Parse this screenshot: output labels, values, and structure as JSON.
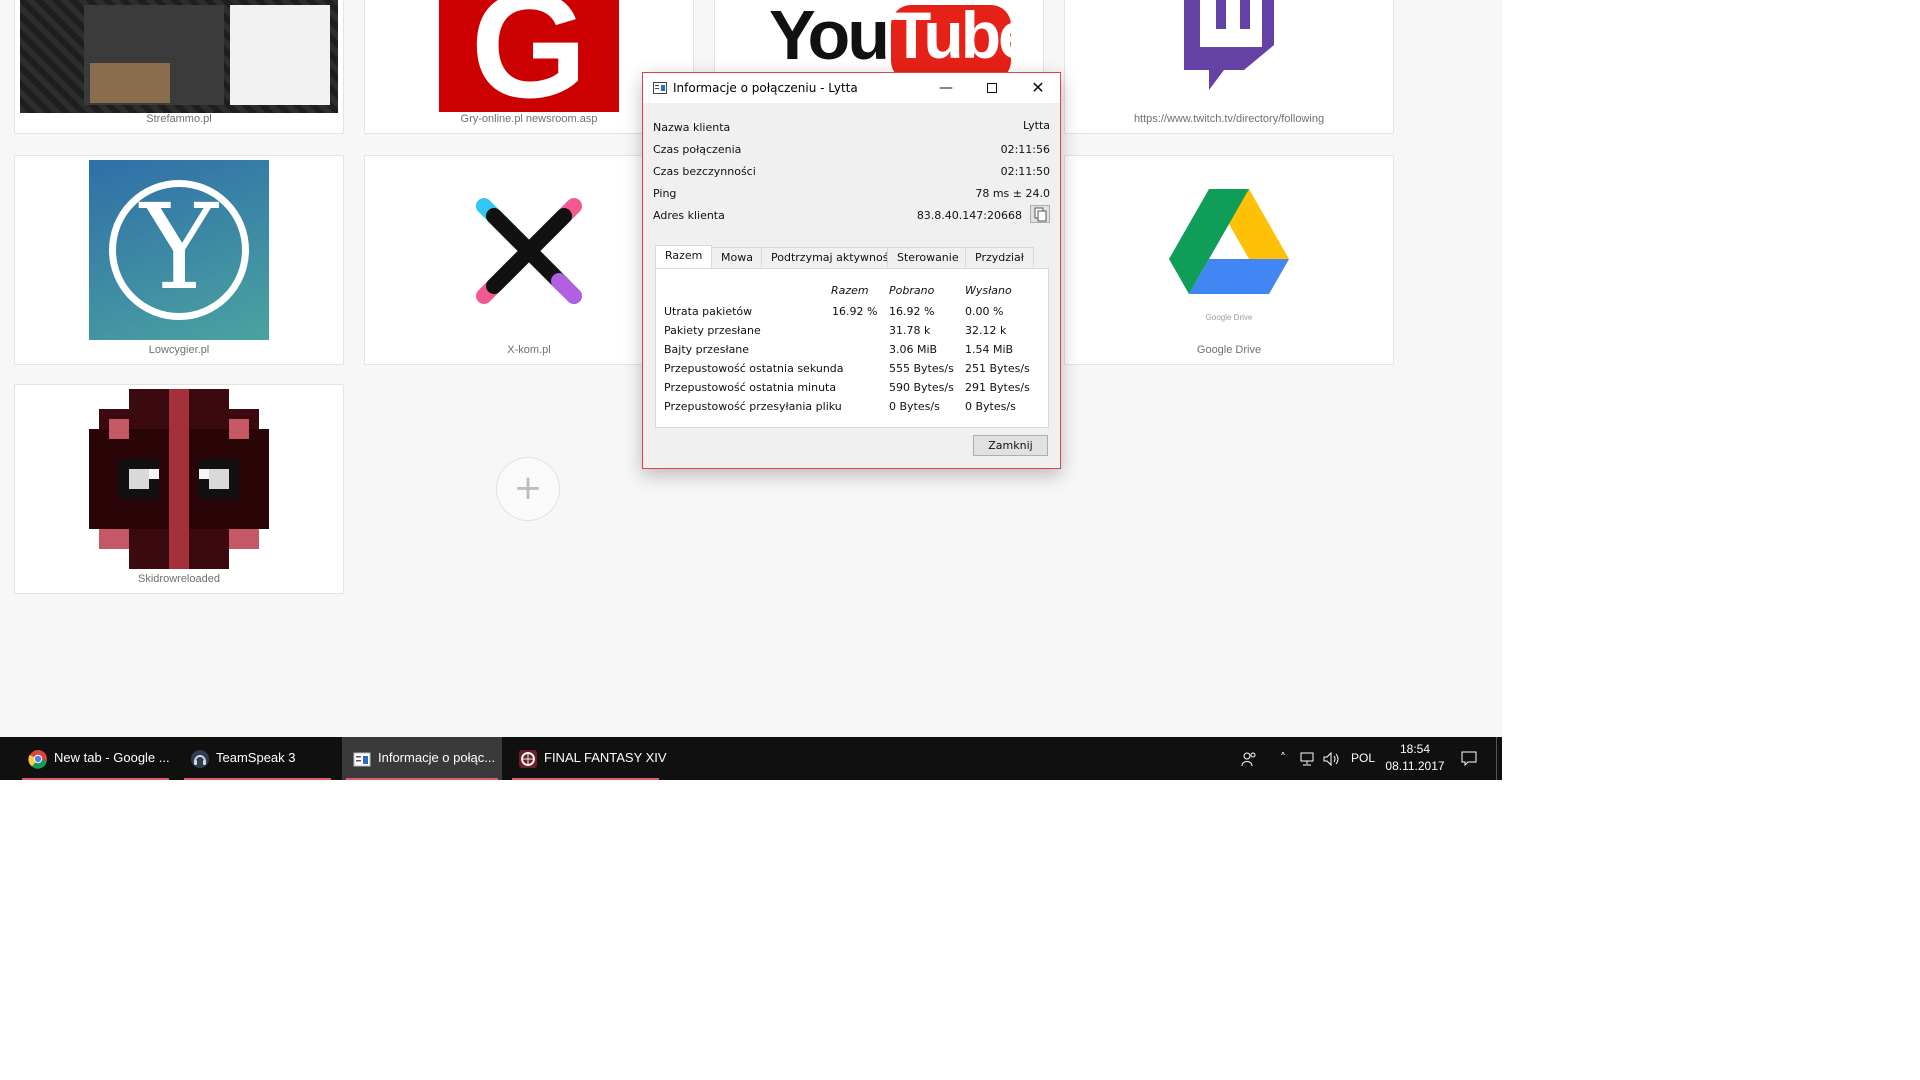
{
  "speed_dial": {
    "tiles": [
      {
        "label": "Strefammo.pl",
        "icon": "strefammo-thumbnail"
      },
      {
        "label": "Gry-online.pl newsroom.asp",
        "icon": "gry-online-logo",
        "logo_text": "G",
        "color": "#cc0000"
      },
      {
        "label": "YouTube",
        "icon": "youtube-logo",
        "logo_you": "You",
        "logo_tube": "Tube",
        "color": "#e62117"
      },
      {
        "label": "https://www.twitch.tv/directory/following",
        "icon": "twitch-logo",
        "color": "#6441a4"
      },
      {
        "label": "Lowcygier.pl",
        "icon": "lowcygier-logo",
        "logo_text": "Y",
        "color": "#3a7fae"
      },
      {
        "label": "X-kom.pl",
        "icon": "x-kom-logo"
      },
      {
        "label": "Google Drive",
        "icon": "google-drive-logo",
        "logo_text": "Google Drive"
      },
      {
        "label": "Skidrowreloaded",
        "icon": "deadpool-pixel-logo"
      }
    ],
    "add_label": "+"
  },
  "dialog": {
    "title": "Informacje o połączeniu - Lytta",
    "info": [
      {
        "label": "Nazwa klienta",
        "value": "Lytta"
      },
      {
        "label": "Czas połączenia",
        "value": "02:11:56"
      },
      {
        "label": "Czas bezczynności",
        "value": "02:11:50"
      },
      {
        "label": "Ping",
        "value": "78 ms ± 24.0"
      },
      {
        "label": "Adres klienta",
        "value": "83.8.40.147:20668"
      }
    ],
    "tabs": [
      "Razem",
      "Mowa",
      "Podtrzymaj aktywność",
      "Sterowanie",
      "Przydział"
    ],
    "active_tab": "Razem",
    "columns": [
      "Razem",
      "Pobrano",
      "Wysłano"
    ],
    "rows": [
      {
        "label": "Utrata pakietów",
        "total": "16.92 %",
        "down": "16.92 %",
        "up": "0.00 %"
      },
      {
        "label": "Pakiety przesłane",
        "total": "",
        "down": "31.78 k",
        "up": "32.12 k"
      },
      {
        "label": "Bajty przesłane",
        "total": "",
        "down": "3.06 MiB",
        "up": "1.54 MiB"
      },
      {
        "label": "Przepustowość ostatnia sekunda",
        "total": "",
        "down": "555 Bytes/s",
        "up": "251 Bytes/s"
      },
      {
        "label": "Przepustowość ostatnia minuta",
        "total": "",
        "down": "590 Bytes/s",
        "up": "291 Bytes/s"
      },
      {
        "label": "Przepustowość przesyłania pliku",
        "total": "",
        "down": "0 Bytes/s",
        "up": "0 Bytes/s"
      }
    ],
    "close_label": "Zamknij"
  },
  "taskbar": {
    "items": [
      {
        "label": "New tab - Google ...",
        "icon": "chrome-icon"
      },
      {
        "label": "TeamSpeak 3",
        "icon": "teamspeak-icon"
      },
      {
        "label": "Informacje o połąc...",
        "icon": "connection-info-icon"
      },
      {
        "label": "FINAL FANTASY XIV",
        "icon": "ffxiv-icon"
      }
    ],
    "language": "POL",
    "time": "18:54",
    "date": "08.11.2017"
  }
}
